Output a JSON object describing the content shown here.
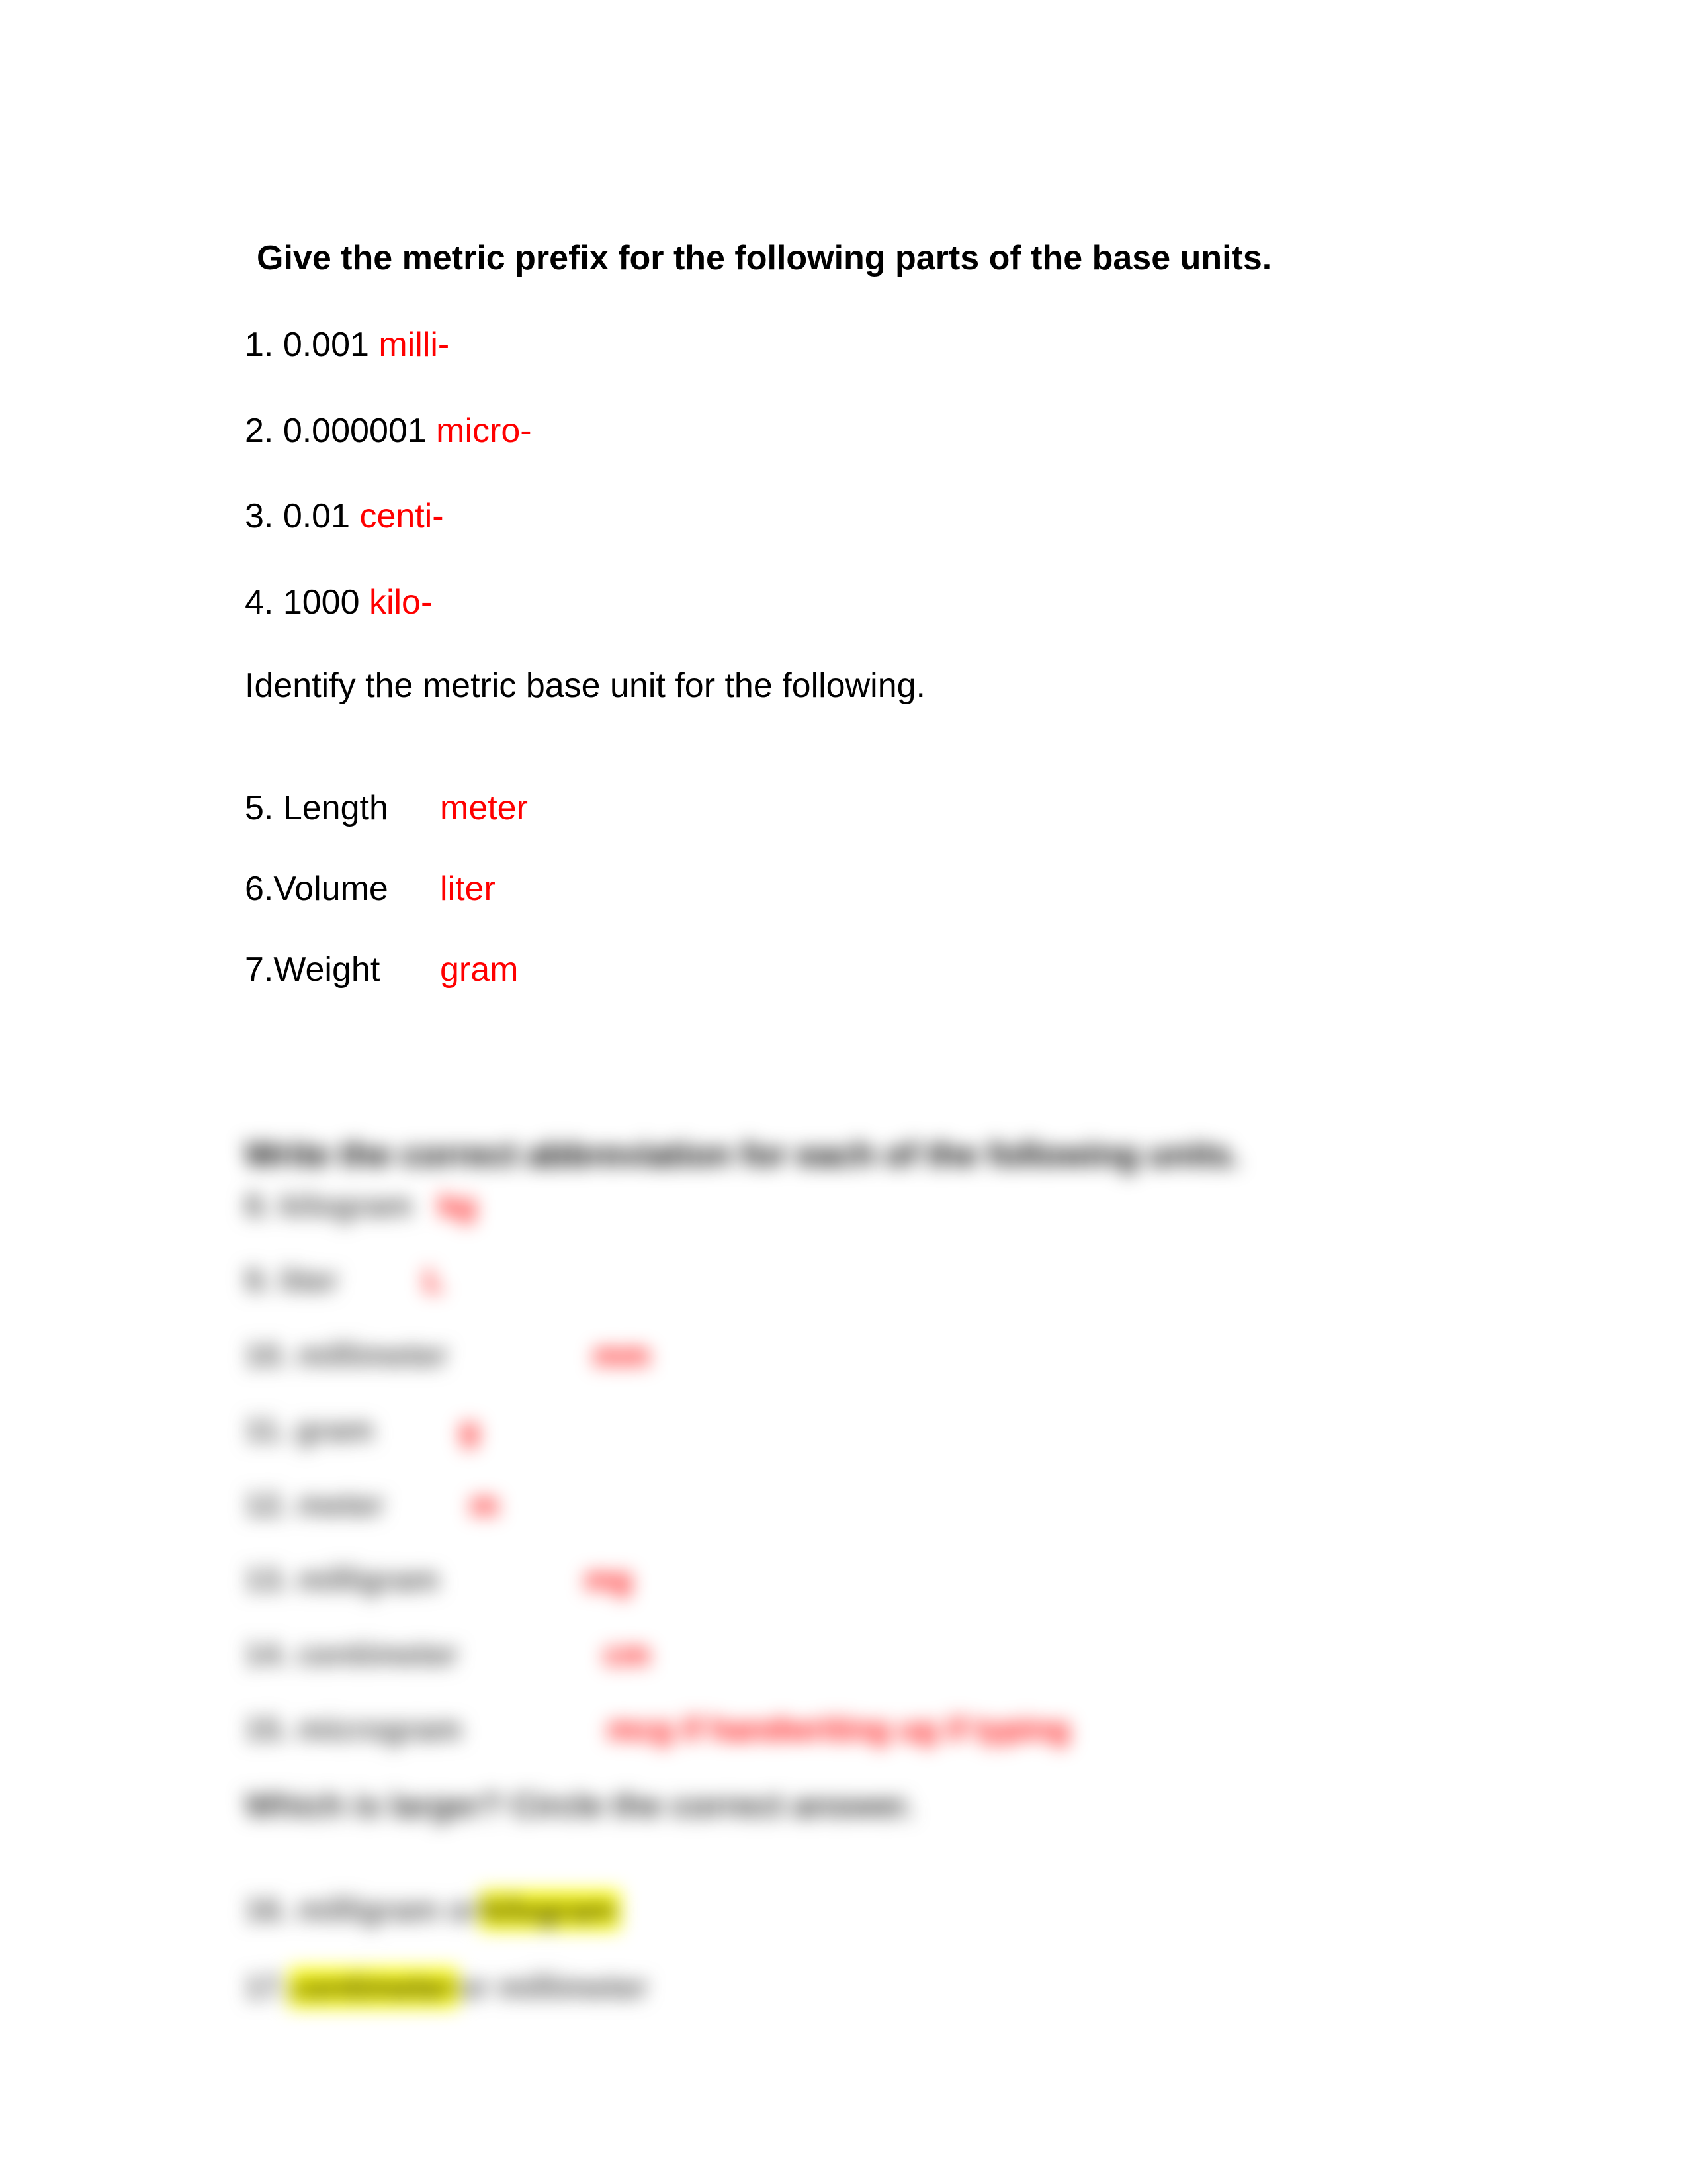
{
  "section1": {
    "heading": "Give the metric prefix for the following parts of the base units.",
    "items": [
      {
        "label": "1. 0.001  ",
        "answer": "milli-"
      },
      {
        "label": "2. 0.000001  ",
        "answer": "micro-"
      },
      {
        "label": "3. 0.01  ",
        "answer": "centi-"
      },
      {
        "label": "4. 1000  ",
        "answer": "kilo-"
      }
    ]
  },
  "section2": {
    "heading": "Identify the metric base unit for the following.",
    "items": [
      {
        "label": "5. Length",
        "answer": "meter"
      },
      {
        "label": "6.Volume",
        "answer": "liter"
      },
      {
        "label": "7.Weight",
        "answer": "gram"
      }
    ]
  },
  "blurred": {
    "heading3": "Write the correct abbreviation for each of the following units.",
    "items": [
      {
        "label": "8. kilogram",
        "gap": "sm",
        "answer": "kg"
      },
      {
        "label": "9. liter",
        "gap": "md",
        "answer": "L"
      },
      {
        "label": "10. millimeter",
        "gap": "lg",
        "answer": "mm"
      },
      {
        "label": "11. gram",
        "gap": "md",
        "answer": "g"
      },
      {
        "label": "12. meter",
        "gap": "md",
        "answer": "m"
      },
      {
        "label": "13. milligram",
        "gap": "lg",
        "answer": "mg"
      },
      {
        "label": "14. centimeter",
        "gap": "lg",
        "answer": "cm"
      },
      {
        "label": "15. microgram",
        "gap": "lg",
        "answer": "mcg if handwriting     ug if typing"
      }
    ],
    "heading4": "Which is larger? Circle the correct answer.",
    "compare": [
      {
        "prefix": "16. milligram or ",
        "highlight": "kilogram",
        "suffix": ""
      },
      {
        "prefix": "17. ",
        "highlight": "centimeter",
        "suffix": " or millimeter"
      }
    ]
  }
}
